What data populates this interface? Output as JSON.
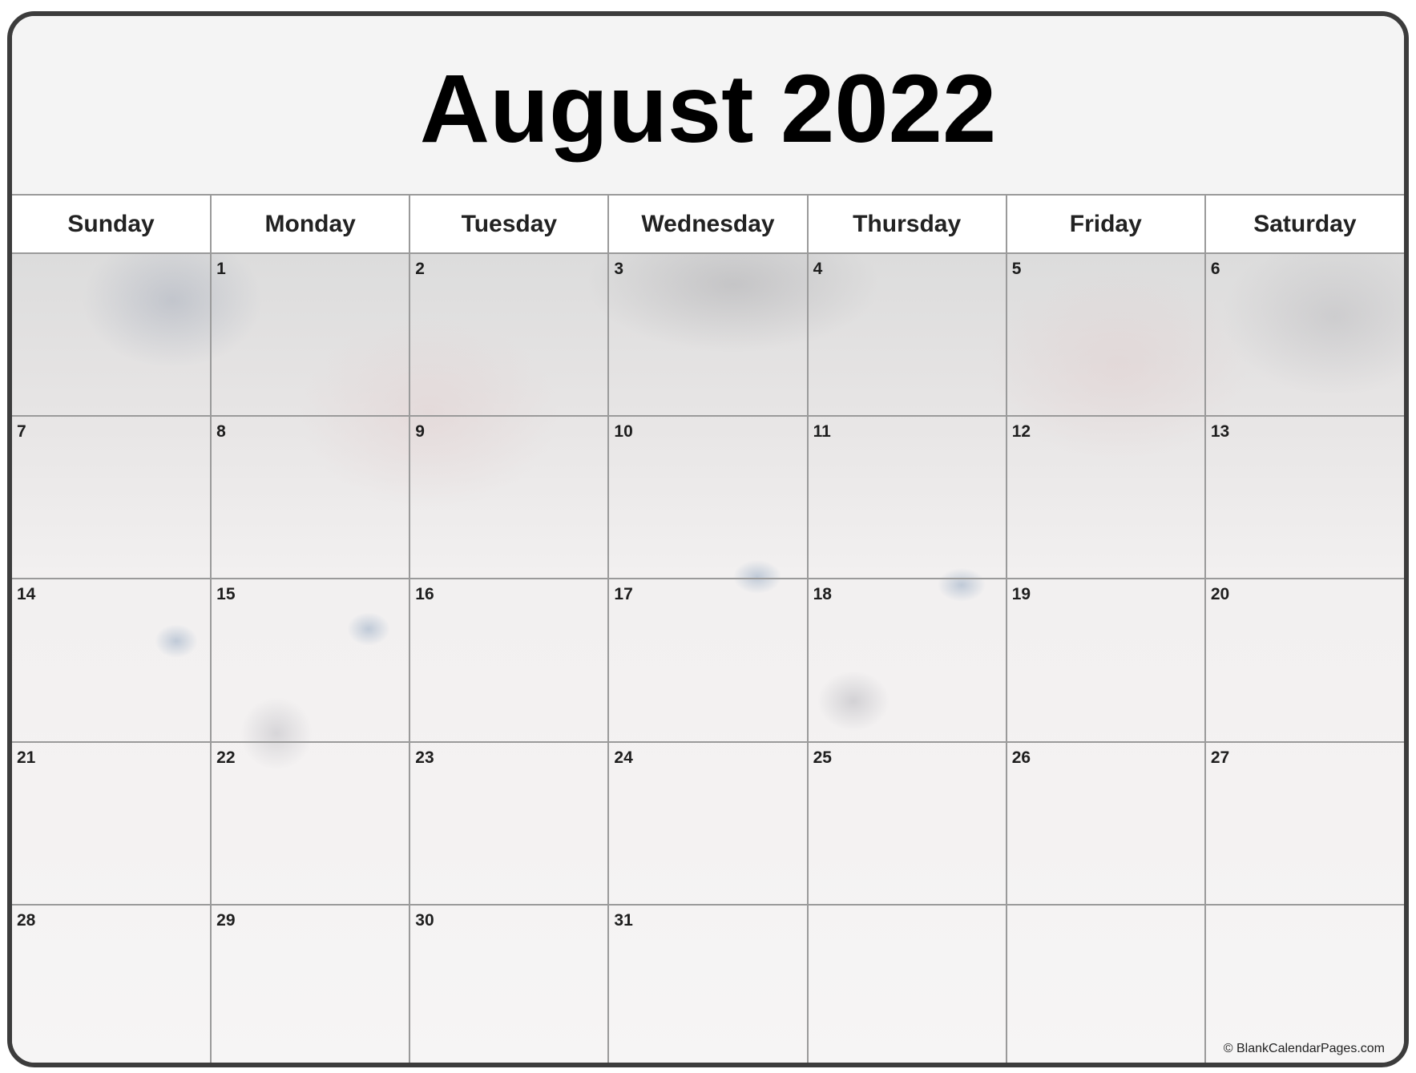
{
  "calendar": {
    "title": "August 2022",
    "month": "August",
    "year": 2022,
    "weekdays": [
      "Sunday",
      "Monday",
      "Tuesday",
      "Wednesday",
      "Thursday",
      "Friday",
      "Saturday"
    ],
    "weeks": [
      [
        "",
        "1",
        "2",
        "3",
        "4",
        "5",
        "6"
      ],
      [
        "7",
        "8",
        "9",
        "10",
        "11",
        "12",
        "13"
      ],
      [
        "14",
        "15",
        "16",
        "17",
        "18",
        "19",
        "20"
      ],
      [
        "21",
        "22",
        "23",
        "24",
        "25",
        "26",
        "27"
      ],
      [
        "28",
        "29",
        "30",
        "31",
        "",
        "",
        ""
      ]
    ],
    "background_image": "faded-kittens-photo",
    "credit": "© BlankCalendarPages.com"
  },
  "colors": {
    "frame_border": "#3c3c3c",
    "grid_line": "#9a9a9a",
    "title_bg": "#f4f4f4",
    "header_bg": "#ffffff",
    "text": "#000000"
  }
}
